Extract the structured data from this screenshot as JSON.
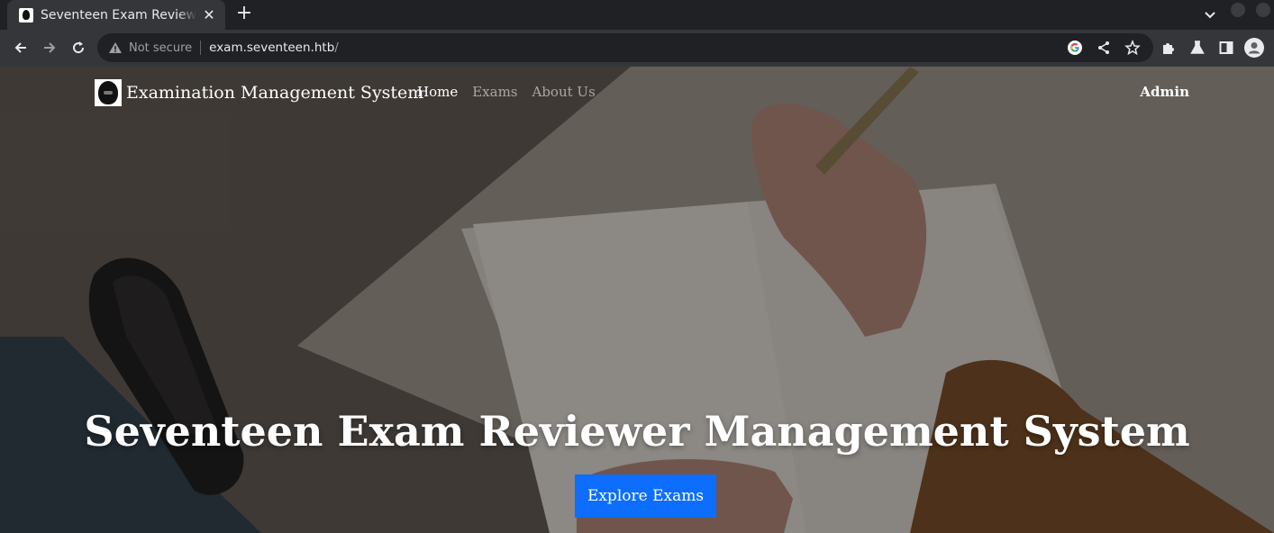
{
  "browser": {
    "tab": {
      "title": "Seventeen Exam Reviewer Management System"
    },
    "address": {
      "security_label": "Not secure",
      "url_host": "exam.seventeen.htb",
      "url_path": "/"
    },
    "icons": [
      "back-icon",
      "forward-icon",
      "reload-icon",
      "warning-icon",
      "google-icon",
      "share-icon",
      "star-icon",
      "extensions-icon",
      "labs-icon",
      "side-panel-icon",
      "profile-icon",
      "chevron-down-icon"
    ]
  },
  "site": {
    "brand": "Examination Management System",
    "nav": [
      {
        "label": "Home",
        "active": true
      },
      {
        "label": "Exams",
        "active": false
      },
      {
        "label": "About Us",
        "active": false
      }
    ],
    "admin_label": "Admin",
    "hero": {
      "headline": "Seventeen Exam Reviewer Management System",
      "cta_label": "Explore Exams"
    }
  },
  "colors": {
    "chrome_dark": "#202124",
    "chrome_toolbar": "#35363a",
    "cta_blue": "#0d6efd"
  }
}
